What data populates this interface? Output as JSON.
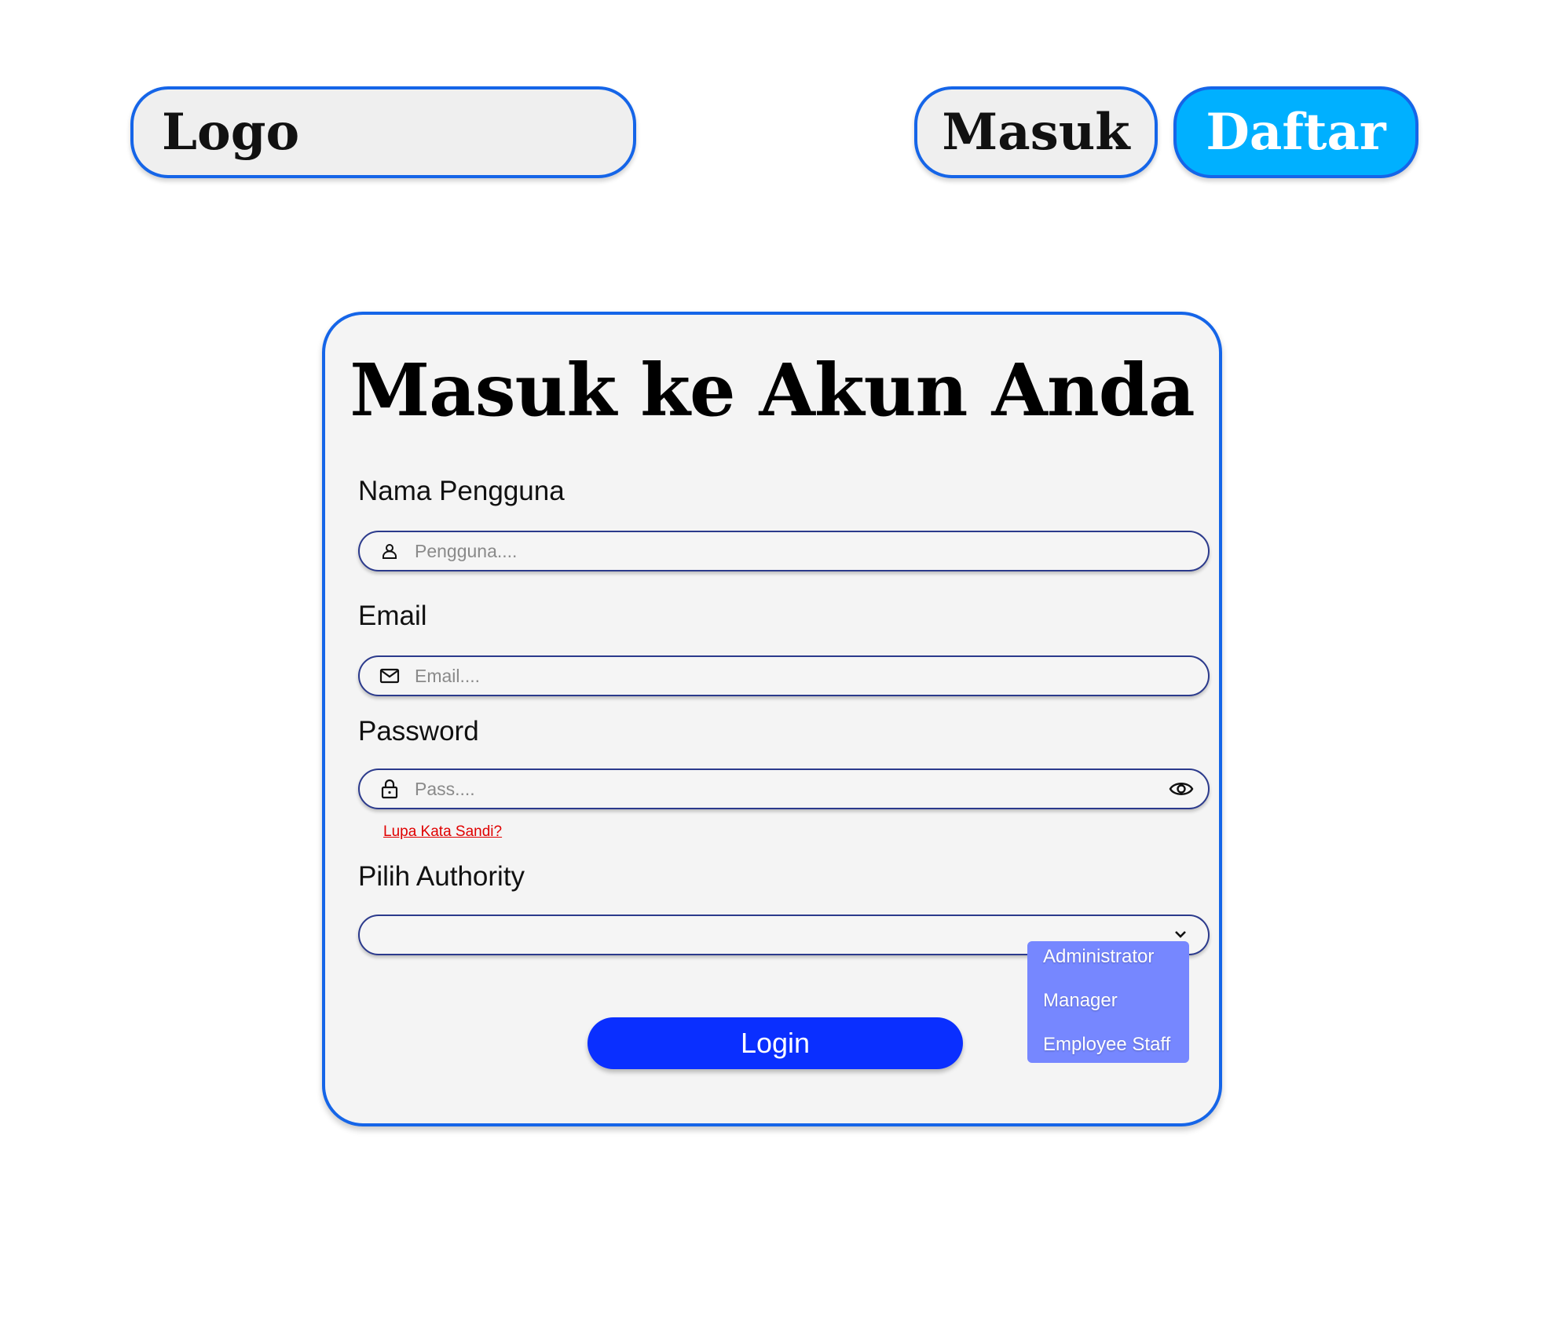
{
  "header": {
    "logo_text": "Logo",
    "login_label": "Masuk",
    "register_label": "Daftar"
  },
  "form": {
    "title": "Masuk ke Akun Anda",
    "username": {
      "label": "Nama Pengguna",
      "placeholder": "Pengguna....",
      "icon": "user-icon"
    },
    "email": {
      "label": "Email",
      "placeholder": "Email....",
      "icon": "mail-icon"
    },
    "password": {
      "label": "Password",
      "placeholder": "Pass....",
      "icon": "lock-icon",
      "toggle_icon": "eye-icon"
    },
    "forgot_label": "Lupa Kata Sandi?",
    "authority": {
      "label": "Pilih Authority",
      "selected": "",
      "options": [
        "Administrator",
        "Manager",
        "Employee Staff"
      ]
    },
    "submit_label": "Login"
  },
  "colors": {
    "border": "#1565e8",
    "register_bg": "#00b0ff",
    "login_bg": "#0a2fff",
    "dropdown_bg": "#7687ff",
    "link": "#e00000"
  }
}
